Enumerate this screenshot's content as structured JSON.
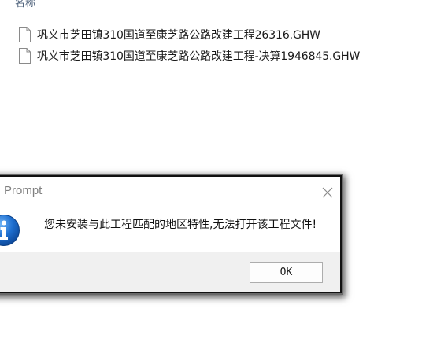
{
  "explorer": {
    "column_header": "名称",
    "files": [
      {
        "name": "巩义市芝田镇310国道至康芝路公路改建工程26316.GHW",
        "icon": "document-icon"
      },
      {
        "name": "巩义市芝田镇310国道至康芝路公路改建工程-决算1946845.GHW",
        "icon": "document-icon"
      }
    ]
  },
  "dialog": {
    "title": "Prompt",
    "message": "您未安装与此工程匹配的地区特性,无法打开该工程文件!",
    "ok_label": "OK",
    "icon": "info-icon",
    "close_icon": "close-icon"
  },
  "colors": {
    "info_icon_blue": "#1565c0",
    "dialog_footer": "#f0f0f0",
    "title_text": "#808080",
    "header_text": "#4c607a"
  }
}
